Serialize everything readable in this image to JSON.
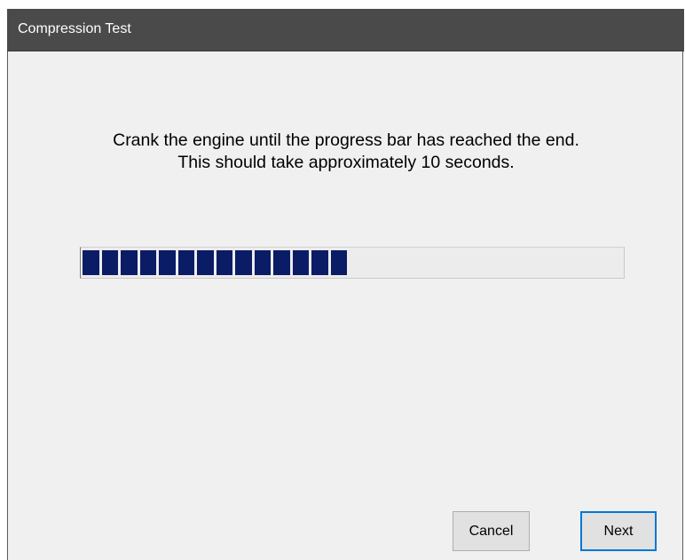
{
  "window": {
    "title": "Compression Test"
  },
  "instructions": {
    "line1": "Crank the engine until the progress bar has reached the end.",
    "line2": "This should take approximately 10 seconds."
  },
  "progress": {
    "percent": 50,
    "filled_blocks": 14,
    "fill_color": "#0b1c66"
  },
  "buttons": {
    "cancel_label": "Cancel",
    "next_label": "Next",
    "focus_color": "#0078d7"
  }
}
